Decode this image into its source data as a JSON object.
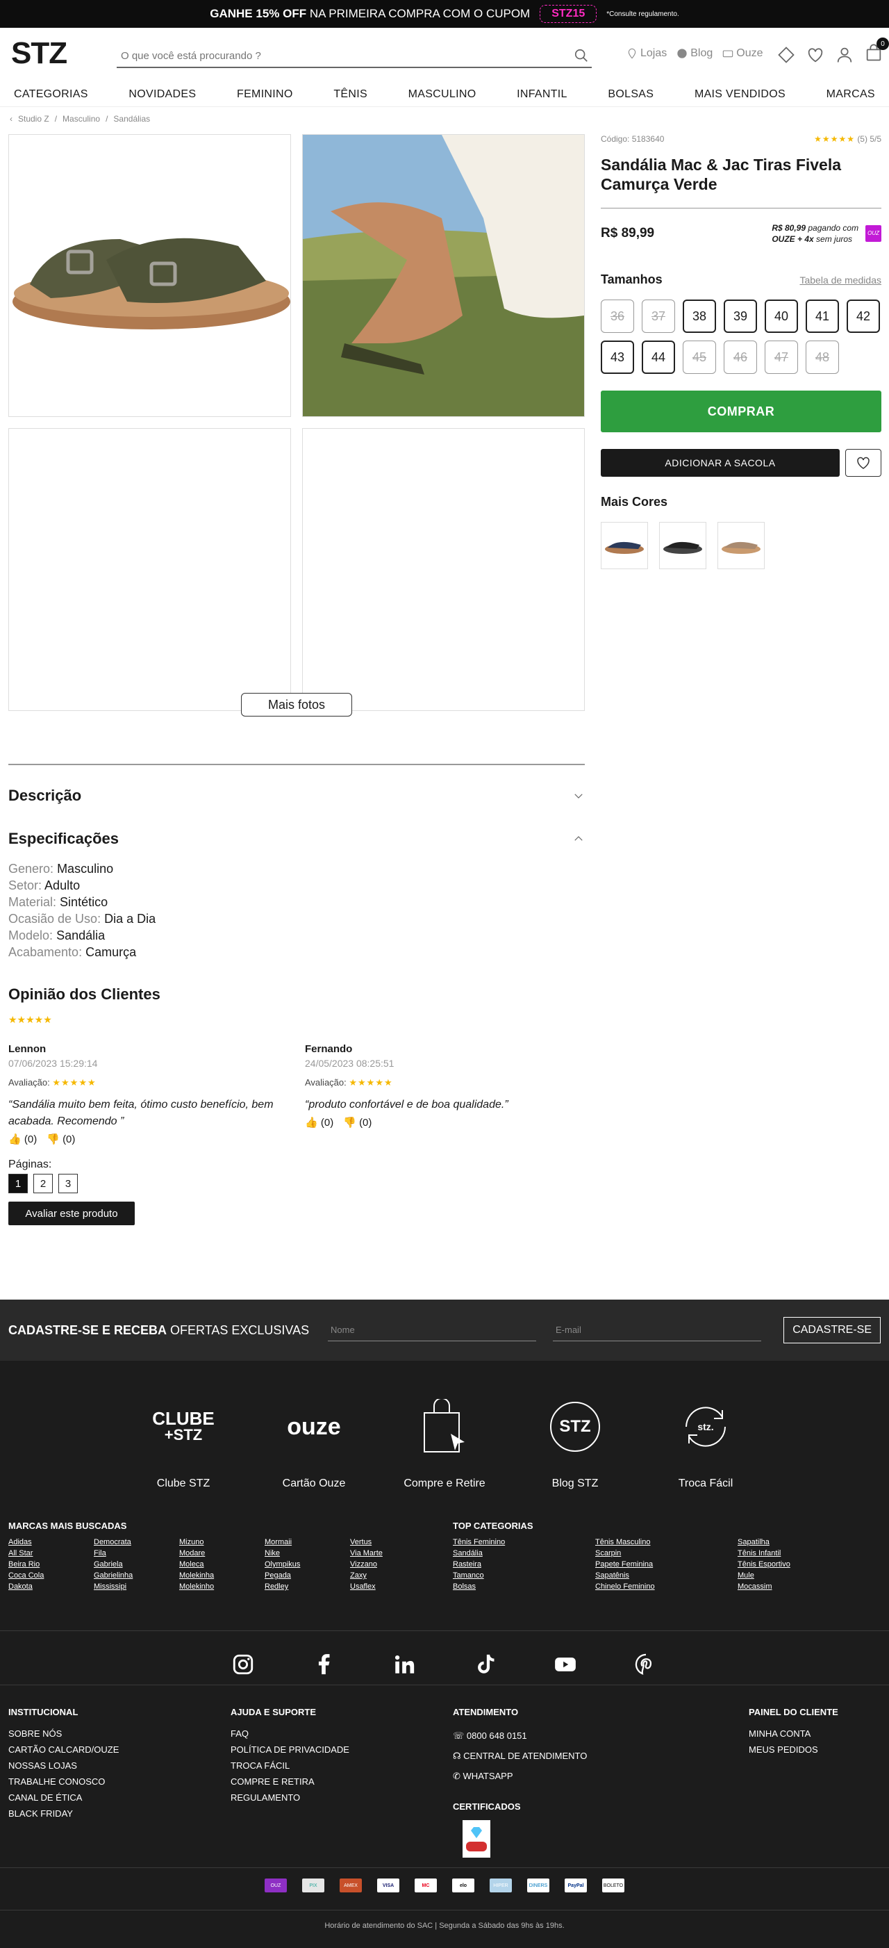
{
  "topbar": {
    "promo_bold": "GANHE 15% OFF",
    "promo_rest": "NA PRIMEIRA COMPRA COM O CUPOM",
    "coupon": "STZ15",
    "note": "*Consulte regulamento."
  },
  "header": {
    "logo": "STZ",
    "search_placeholder": "O que você está procurando ?",
    "links": [
      "Lojas",
      "Blog",
      "Ouze"
    ],
    "cart_count": "0"
  },
  "nav": [
    "CATEGORIAS",
    "NOVIDADES",
    "FEMININO",
    "TÊNIS",
    "MASCULINO",
    "INFANTIL",
    "BOLSAS",
    "MAIS VENDIDOS",
    "MARCAS"
  ],
  "breadcrumb": [
    "Studio Z",
    "Masculino",
    "Sandálias"
  ],
  "gallery": {
    "more_label": "Mais fotos"
  },
  "product": {
    "code": "Código: 5183640",
    "rating_text": "(5) 5/5",
    "title": "Sandália Mac & Jac Tiras Fivela Camurça Verde",
    "price": "R$ 89,99",
    "ouze_price": "R$ 80,99",
    "ouze_line1": "pagando com",
    "ouze_line2": "OUZE + 4x",
    "ouze_line3": "sem juros",
    "ouze_logo": "OUZ",
    "sizes_title": "Tamanhos",
    "size_table": "Tabela de medidas",
    "sizes": [
      {
        "n": "36",
        "available": false
      },
      {
        "n": "37",
        "available": false
      },
      {
        "n": "38",
        "available": true
      },
      {
        "n": "39",
        "available": true
      },
      {
        "n": "40",
        "available": true
      },
      {
        "n": "41",
        "available": true
      },
      {
        "n": "42",
        "available": true
      },
      {
        "n": "43",
        "available": true
      },
      {
        "n": "44",
        "available": true
      },
      {
        "n": "45",
        "available": false
      },
      {
        "n": "46",
        "available": false
      },
      {
        "n": "47",
        "available": false
      },
      {
        "n": "48",
        "available": false
      }
    ],
    "buy": "COMPRAR",
    "add_bag": "ADICIONAR A SACOLA",
    "more_colors": "Mais Cores"
  },
  "sections": {
    "description": "Descrição",
    "specs": "Especificações"
  },
  "specs": [
    {
      "k": "Genero:",
      "v": "Masculino"
    },
    {
      "k": "Setor:",
      "v": "Adulto"
    },
    {
      "k": "Material:",
      "v": "Sintético"
    },
    {
      "k": "Ocasião de Uso:",
      "v": "Dia a Dia"
    },
    {
      "k": "Modelo:",
      "v": "Sandália"
    },
    {
      "k": "Acabamento:",
      "v": "Camurça"
    }
  ],
  "reviews": {
    "title": "Opinião dos Clientes",
    "rating_label": "Avaliação:",
    "items": [
      {
        "name": "Lennon",
        "date": "07/06/2023 15:29:14",
        "text": "“Sandália muito bem feita, ótimo custo benefício, bem acabada. Recomendo ”",
        "up": "(0)",
        "down": "(0)"
      },
      {
        "name": "Fernando",
        "date": "24/05/2023 08:25:51",
        "text": "“produto confortável e de boa qualidade.”",
        "up": "(0)",
        "down": "(0)"
      }
    ],
    "pages_label": "Páginas:",
    "pages": [
      "1",
      "2",
      "3"
    ],
    "rate_button": "Avaliar este produto"
  },
  "newsletter": {
    "bold": "CADASTRE-SE E RECEBA",
    "rest": "OFERTAS EXCLUSIVAS",
    "name_placeholder": "Nome",
    "email_placeholder": "E-mail",
    "button": "CADASTRE-SE"
  },
  "footer": {
    "cards": [
      "Clube STZ",
      "Cartão Ouze",
      "Compre e Retire",
      "Blog STZ",
      "Troca Fácil"
    ],
    "clube_logo_1": "CLUBE",
    "clube_logo_2": "+STZ",
    "ouze_logo": "ouze",
    "blog_logo": "STZ",
    "troca_logo": "stz.",
    "brands_title": "MARCAS MAIS BUSCADAS",
    "brands": [
      "Adidas",
      "Democrata",
      "Mizuno",
      "Mormaii",
      "Vertus",
      "All Star",
      "Fila",
      "Modare",
      "Nike",
      "Via Marte",
      "Beira Rio",
      "Gabriela",
      "Moleca",
      "Olympikus",
      "Vizzano",
      "Coca Cola",
      "Gabrielinha",
      "Molekinha",
      "Pegada",
      "Zaxy",
      "Dakota",
      "Mississipi",
      "Molekinho",
      "Redley",
      "Usaflex"
    ],
    "top_title": "TOP CATEGORIAS",
    "top": [
      "Tênis Feminino",
      "Tênis Masculino",
      "Sapatilha",
      "Sandália",
      "Scarpin",
      "Tênis Infantil",
      "Rasteira",
      "Papete Feminina",
      "Tênis Esportivo",
      "Tamanco",
      "Sapatênis",
      "Mule",
      "Bolsas",
      "Chinelo Feminino",
      "Mocassim"
    ],
    "inst_title": "INSTITUCIONAL",
    "inst": [
      "SOBRE NÓS",
      "CARTÃO CALCARD/OUZE",
      "NOSSAS LOJAS",
      "TRABALHE CONOSCO",
      "CANAL DE ÉTICA",
      "BLACK FRIDAY"
    ],
    "help_title": "AJUDA E SUPORTE",
    "help": [
      "FAQ",
      "POLÍTICA DE PRIVACIDADE",
      "TROCA FÁCIL",
      "COMPRE E RETIRA",
      "REGULAMENTO"
    ],
    "att_title": "ATENDIMENTO",
    "att": [
      "0800 648 0151",
      "CENTRAL DE ATENDIMENTO",
      "WHATSAPP"
    ],
    "cert_title": "CERTIFICADOS",
    "panel_title": "PAINEL DO CLIENTE",
    "panel": [
      "MINHA CONTA",
      "MEUS PEDIDOS"
    ],
    "payments": [
      "OUZ",
      "PIX",
      "AMEX",
      "VISA",
      "MC",
      "elo",
      "HIPER",
      "DINERS",
      "PayPal",
      "BOLETO"
    ],
    "sac": "Horário de atendimento do SAC | Segunda a Sábado das 9hs às 19hs."
  }
}
